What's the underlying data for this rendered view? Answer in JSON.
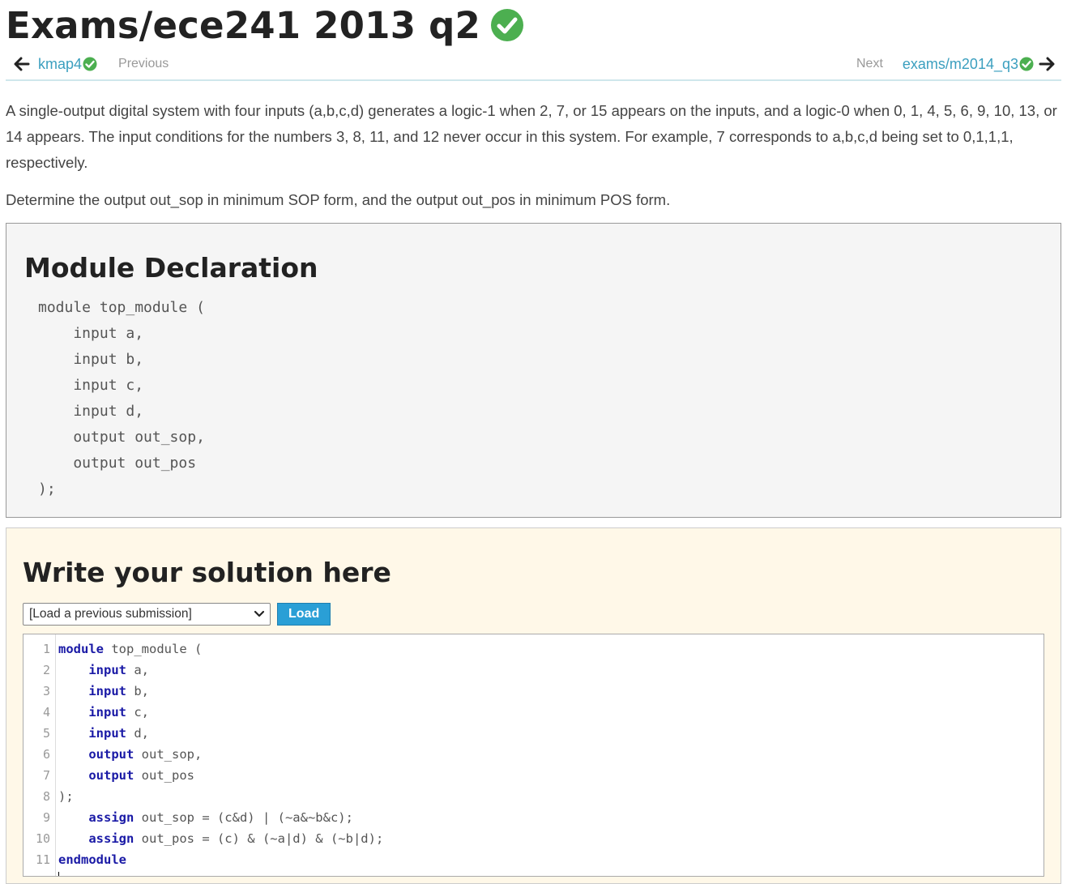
{
  "page": {
    "title": "Exams/ece241 2013 q2"
  },
  "nav": {
    "prev_link": "kmap4",
    "prev_label": "Previous",
    "next_label": "Next",
    "next_link": "exams/m2014_q3"
  },
  "description": {
    "paragraph1": "A single-output digital system with four inputs (a,b,c,d) generates a logic-1 when 2, 7, or 15 appears on the inputs, and a logic-0 when 0, 1, 4, 5, 6, 9, 10, 13, or 14 appears. The input conditions for the numbers 3, 8, 11, and 12 never occur in this system. For example, 7 corresponds to a,b,c,d being set to 0,1,1,1, respectively.",
    "paragraph2": "Determine the output out_sop in minimum SOP form, and the output out_pos in minimum POS form."
  },
  "declaration": {
    "heading": "Module Declaration",
    "code": "module top_module (\n    input a,\n    input b,\n    input c,\n    input d,\n    output out_sop,\n    output out_pos\n);"
  },
  "solution": {
    "heading": "Write your solution here",
    "select_value": "[Load a previous submission]",
    "load_button": "Load",
    "lines": [
      {
        "num": "1",
        "indent": "",
        "kw": "module",
        "rest": " top_module ("
      },
      {
        "num": "2",
        "indent": "    ",
        "kw": "input",
        "rest": " a,"
      },
      {
        "num": "3",
        "indent": "    ",
        "kw": "input",
        "rest": " b,"
      },
      {
        "num": "4",
        "indent": "    ",
        "kw": "input",
        "rest": " c,"
      },
      {
        "num": "5",
        "indent": "    ",
        "kw": "input",
        "rest": " d,"
      },
      {
        "num": "6",
        "indent": "    ",
        "kw": "output",
        "rest": " out_sop,"
      },
      {
        "num": "7",
        "indent": "    ",
        "kw": "output",
        "rest": " out_pos"
      },
      {
        "num": "8",
        "indent": "",
        "kw": "",
        "rest": ");"
      },
      {
        "num": "9",
        "indent": "    ",
        "kw": "assign",
        "rest": " out_sop = (c&d) | (~a&~b&c);"
      },
      {
        "num": "10",
        "indent": "    ",
        "kw": "assign",
        "rest": " out_pos = (c) & (~a|d) & (~b|d);"
      },
      {
        "num": "11",
        "indent": "",
        "kw": "endmodule",
        "rest": ""
      }
    ]
  },
  "colors": {
    "accent_link": "#3b9fbf",
    "success_green": "#4caf50",
    "keyword_blue": "#1a1aa6",
    "load_button_bg": "#2a9fd6",
    "solution_bg": "#fff8e8",
    "declaration_bg": "#f5f5f5"
  },
  "icons": {
    "title_status": "check-circle-icon",
    "prev_arrow": "arrow-left-icon",
    "next_arrow": "arrow-right-icon",
    "select_caret": "chevron-down-icon"
  }
}
